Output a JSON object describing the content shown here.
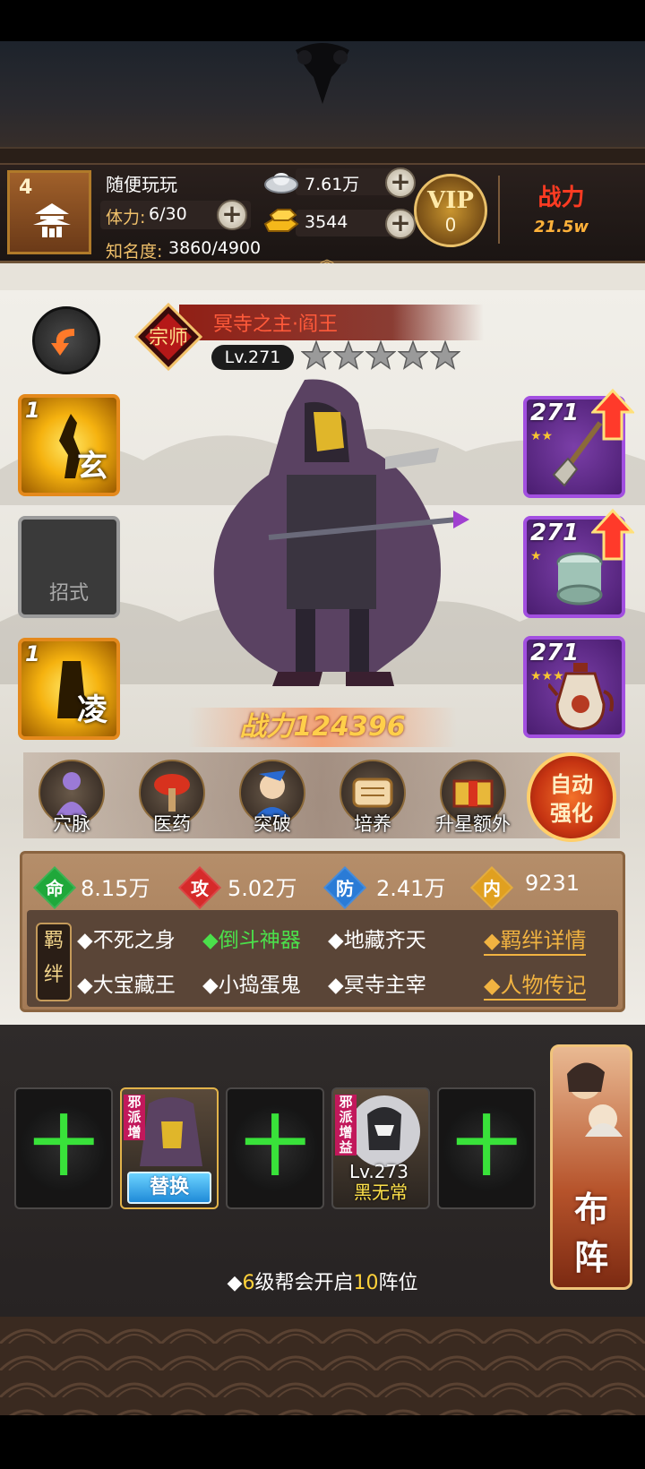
{
  "header": {
    "player_level": "4",
    "player_name": "随便玩玩",
    "stamina_label": "体力:",
    "stamina_value": "6/30",
    "fame_label": "知名度:",
    "fame_value": "3860/4900",
    "silver": "7.61万",
    "gold": "3544",
    "vip_label": "VIP",
    "vip_level": "0",
    "power_label": "战力",
    "power_value": "21.5w"
  },
  "hero": {
    "rank_badge": "宗师",
    "title": "冥寺之主·阎王",
    "level": "Lv.271",
    "stars_total": 5,
    "power_text": "战力124396"
  },
  "skills": [
    {
      "num": "1",
      "char": "玄",
      "state": "active"
    },
    {
      "num": "",
      "char": "",
      "label": "招式",
      "state": "empty"
    },
    {
      "num": "1",
      "char": "凌",
      "state": "active"
    }
  ],
  "equipment": [
    {
      "level": "271",
      "stars": "★★",
      "item": "shovel",
      "upgradable": true
    },
    {
      "level": "271",
      "stars": "★",
      "item": "jade-bracelet",
      "upgradable": true
    },
    {
      "level": "271",
      "stars": "★★★",
      "item": "wine-pot",
      "upgradable": false
    }
  ],
  "functions": [
    {
      "label": "穴脉",
      "icon": "meridian-icon"
    },
    {
      "label": "医药",
      "icon": "medicine-icon"
    },
    {
      "label": "突破",
      "icon": "breakthrough-icon"
    },
    {
      "label": "培养",
      "icon": "cultivate-icon"
    },
    {
      "label": "升星额外",
      "icon": "star-up-icon"
    }
  ],
  "auto_strengthen": {
    "line1": "自动",
    "line2": "强化"
  },
  "stats": [
    {
      "label": "命",
      "value": "8.15万",
      "color": "#1fa83a"
    },
    {
      "label": "攻",
      "value": "5.02万",
      "color": "#d62a2a"
    },
    {
      "label": "防",
      "value": "2.41万",
      "color": "#2a7bd6"
    },
    {
      "label": "内",
      "value": "9231",
      "color": "#e0a020"
    }
  ],
  "bonds": {
    "tag_line1": "羁",
    "tag_line2": "绊",
    "items": [
      {
        "text": "◆不死之身",
        "active": false
      },
      {
        "text": "◆倒斗神器",
        "active": true
      },
      {
        "text": "◆地藏齐天",
        "active": false
      },
      {
        "text": "◆大宝藏王",
        "active": false
      },
      {
        "text": "◆小捣蛋鬼",
        "active": false
      },
      {
        "text": "◆冥寺主宰",
        "active": false
      }
    ],
    "detail_link": "◆羁绊详情",
    "bio_link": "◆人物传记"
  },
  "lineup": {
    "slots": [
      {
        "type": "empty",
        "symbol": "十"
      },
      {
        "type": "current",
        "tag": "邪派增",
        "button": "替换"
      },
      {
        "type": "empty",
        "symbol": "十"
      },
      {
        "type": "member",
        "tag": "邪派增益",
        "level": "Lv.273",
        "name": "黑无常"
      },
      {
        "type": "empty",
        "symbol": "十"
      }
    ],
    "formation_line1": "布",
    "formation_line2": "阵",
    "tip_prefix": "◆",
    "tip_n1": "6",
    "tip_mid": "级帮会开启",
    "tip_n2": "10",
    "tip_suffix": "阵位"
  }
}
